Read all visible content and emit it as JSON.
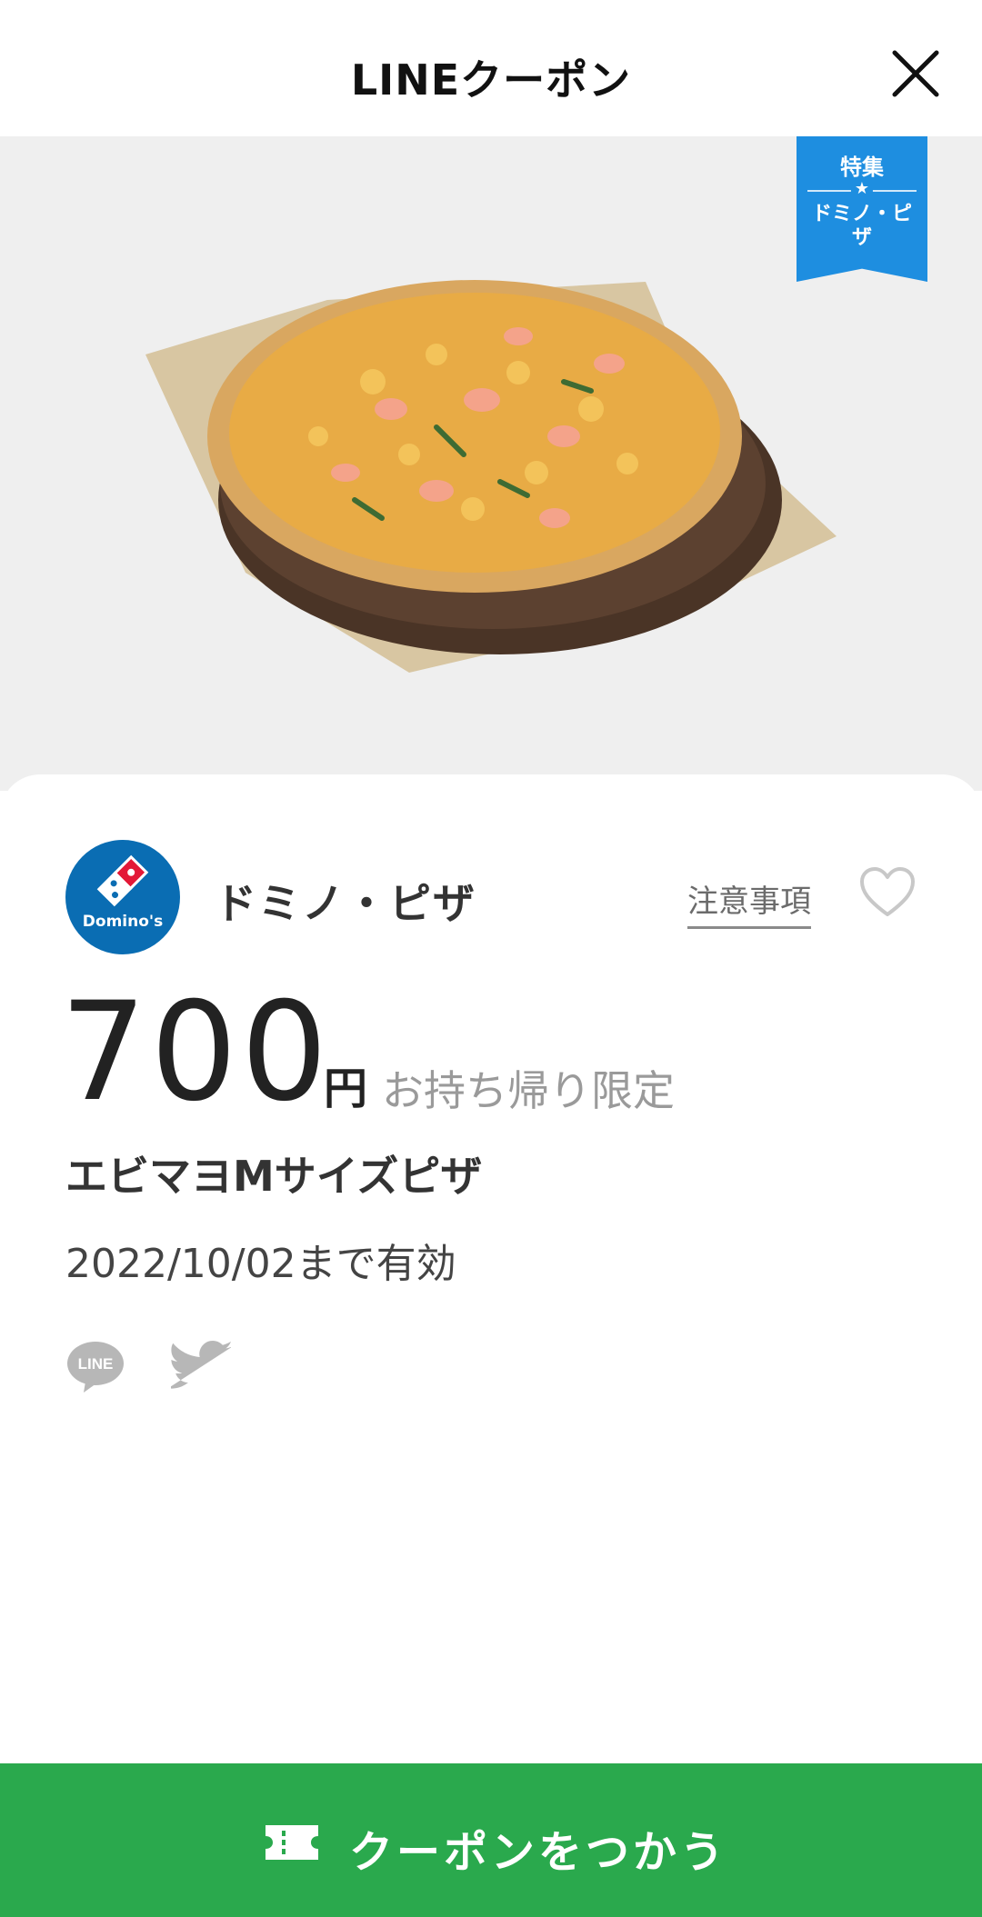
{
  "header": {
    "title": "LINEクーポン"
  },
  "hero": {
    "badge_top": "特集",
    "badge_star": "★",
    "badge_bottom": "ドミノ・ピザ"
  },
  "shop": {
    "name": "ドミノ・ピザ",
    "logo_text": "Domino's",
    "notice_label": "注意事項"
  },
  "coupon": {
    "price": "700",
    "currency": "円",
    "condition": "お持ち帰り限定",
    "item_name": "エビマヨMサイズピザ",
    "valid_until": "2022/10/02まで有効"
  },
  "share": {
    "line_label": "LINE"
  },
  "action": {
    "use_label": "クーポンをつかう"
  },
  "colors": {
    "accent_green": "#2aa94d",
    "badge_blue": "#1e8ee0",
    "domino_blue": "#0a6db3",
    "domino_red": "#e31837"
  }
}
